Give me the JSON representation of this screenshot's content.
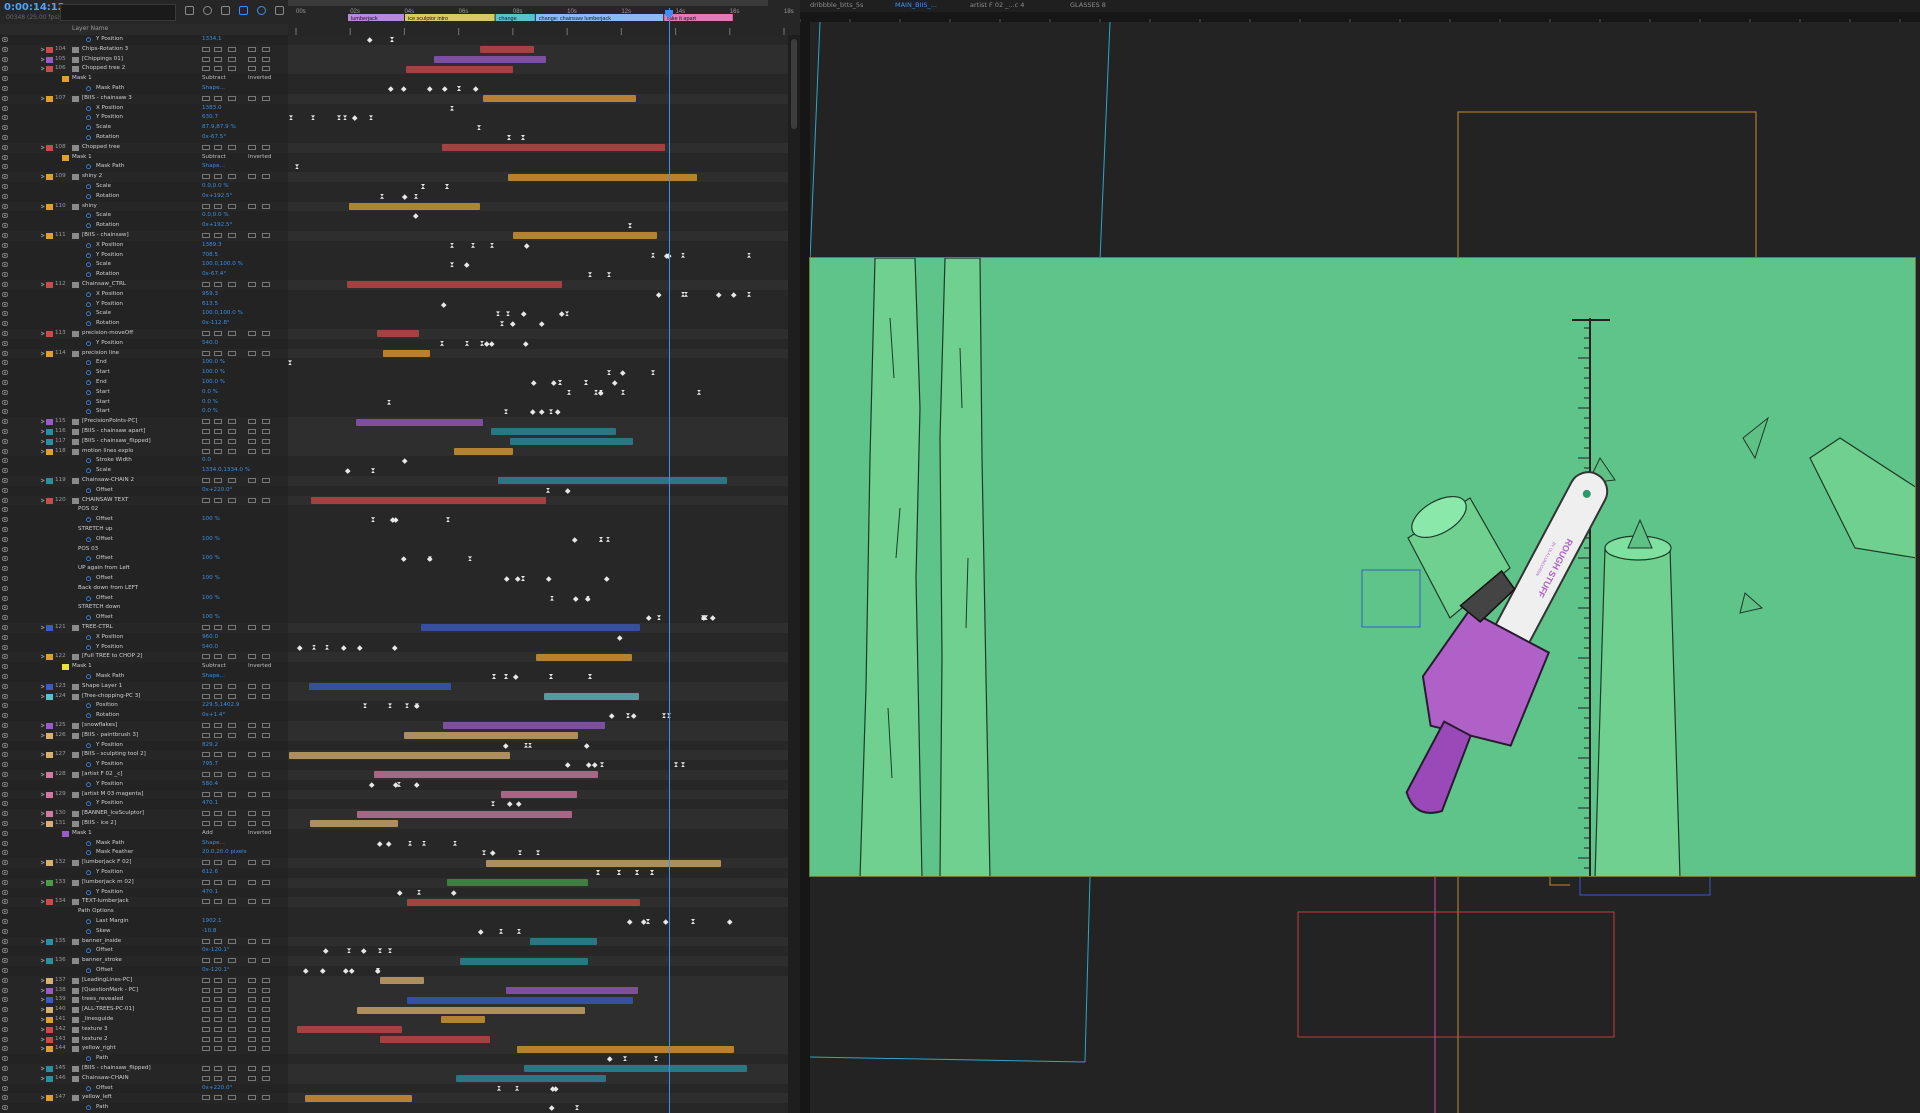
{
  "timeline": {
    "timecode": "0:00:14:12",
    "timecode_sub": "00348 (25.00 fps)",
    "search_placeholder": "",
    "layer_name_header": "Layer Name",
    "ruler_ticks": [
      "00s",
      "02s",
      "04s",
      "06s",
      "08s",
      "10s",
      "12s",
      "14s",
      "16s",
      "18s"
    ],
    "markers": [
      {
        "label": "lumberjack",
        "color": "#b68ad8"
      },
      {
        "label": "ice sculptor intro",
        "color": "#d8c86a"
      },
      {
        "label": "change",
        "color": "#5bc2c8"
      },
      {
        "label": "change: chainsaw lumberjack",
        "color": "#8fb8f0"
      },
      {
        "label": "take it apart",
        "color": "#e07ab8"
      }
    ],
    "rows": [
      {
        "k": "p",
        "name": "Y Position",
        "value": "1334.1",
        "kf": [
          [
            0,
            "x"
          ]
        ]
      },
      {
        "k": "l",
        "n": "104",
        "name": "Chips-Rotation 3",
        "color": "#cc4a4a"
      },
      {
        "k": "l",
        "n": "105",
        "name": "[Chippings 01]",
        "color": "#9a5bc8"
      },
      {
        "k": "l",
        "n": "106",
        "name": "Chopped tree 2",
        "color": "#cc4a4a"
      },
      {
        "k": "m",
        "name": "Mask 1",
        "color": "#e0a030",
        "mode": "Subtract",
        "inv": "Inverted"
      },
      {
        "k": "p",
        "name": "Mask Path",
        "value": "Shape..."
      },
      {
        "k": "l",
        "n": "107",
        "name": "[BIIS - chainsaw 3",
        "color": "#e0a030"
      },
      {
        "k": "p",
        "name": "X Position",
        "value": "1383.0"
      },
      {
        "k": "p",
        "name": "Y Position",
        "value": "630.7"
      },
      {
        "k": "p",
        "name": "Scale",
        "value": "87.9,87.9 %"
      },
      {
        "k": "p",
        "name": "Rotation",
        "value": "0x-67.5°"
      },
      {
        "k": "l",
        "n": "108",
        "name": "Chopped tree",
        "color": "#cc4a4a"
      },
      {
        "k": "m",
        "name": "Mask 1",
        "color": "#e0a030",
        "mode": "Subtract",
        "inv": "Inverted"
      },
      {
        "k": "p",
        "name": "Mask Path",
        "value": "Shape..."
      },
      {
        "k": "l",
        "n": "109",
        "name": "shiny 2",
        "color": "#e0a030"
      },
      {
        "k": "p",
        "name": "Scale",
        "value": "0.0,0.0 %"
      },
      {
        "k": "p",
        "name": "Rotation",
        "value": "0x+192.5°"
      },
      {
        "k": "l",
        "n": "110",
        "name": "shiny",
        "color": "#e0a030"
      },
      {
        "k": "p",
        "name": "Scale",
        "value": "0.0,0.0 %"
      },
      {
        "k": "p",
        "name": "Rotation",
        "value": "0x+192.5°"
      },
      {
        "k": "l",
        "n": "111",
        "name": "[BIIS - chainsaw]",
        "color": "#e0a030"
      },
      {
        "k": "p",
        "name": "X Position",
        "value": "1389.3"
      },
      {
        "k": "p",
        "name": "Y Position",
        "value": "708.5"
      },
      {
        "k": "p",
        "name": "Scale",
        "value": "100.0,100.0 %"
      },
      {
        "k": "p",
        "name": "Rotation",
        "value": "0x-67.4°"
      },
      {
        "k": "l",
        "n": "112",
        "name": "Chainsaw_CTRL",
        "color": "#cc4a4a"
      },
      {
        "k": "p",
        "name": "X Position",
        "value": "959.3"
      },
      {
        "k": "p",
        "name": "Y Position",
        "value": "613.5"
      },
      {
        "k": "p",
        "name": "Scale",
        "value": "100.0,100.0 %"
      },
      {
        "k": "p",
        "name": "Rotation",
        "value": "0x-112.8°"
      },
      {
        "k": "l",
        "n": "113",
        "name": "precision-moveOff",
        "color": "#cc4a4a"
      },
      {
        "k": "p",
        "name": "Y Position",
        "value": "540.0"
      },
      {
        "k": "l",
        "n": "114",
        "name": "precision line",
        "color": "#e0a030"
      },
      {
        "k": "p",
        "name": "End",
        "value": "100.0 %"
      },
      {
        "k": "p",
        "name": "Start",
        "value": "100.0 %"
      },
      {
        "k": "p",
        "name": "End",
        "value": "100.0 %"
      },
      {
        "k": "p",
        "name": "Start",
        "value": "0.0 %"
      },
      {
        "k": "p",
        "name": "Start",
        "value": "0.0 %"
      },
      {
        "k": "p",
        "name": "Start",
        "value": "0.0 %"
      },
      {
        "k": "l",
        "n": "115",
        "name": "[PrecisionPoints-PC]",
        "color": "#9a5bc8"
      },
      {
        "k": "l",
        "n": "116",
        "name": "[BIIS - chainsaw apart]",
        "color": "#2a8fa0"
      },
      {
        "k": "l",
        "n": "117",
        "name": "[BIIS - chainsaw_flipped]",
        "color": "#2a8fa0"
      },
      {
        "k": "l",
        "n": "118",
        "name": "motion lines explo",
        "color": "#e0a030"
      },
      {
        "k": "p",
        "name": "Stroke Width",
        "value": "0.0"
      },
      {
        "k": "p",
        "name": "Scale",
        "value": "1334.0,1334.0 %"
      },
      {
        "k": "l",
        "n": "119",
        "name": "Chainsaw-CHAIN 2",
        "color": "#2a8fa0"
      },
      {
        "k": "p",
        "name": "Offset",
        "value": "0x+220.0°"
      },
      {
        "k": "l",
        "n": "120",
        "name": "CHAINSAW TEXT",
        "color": "#cc4a4a"
      },
      {
        "k": "g",
        "name": "POS 02"
      },
      {
        "k": "p",
        "name": "Offset",
        "value": "100 %"
      },
      {
        "k": "g",
        "name": "STRETCH up"
      },
      {
        "k": "p",
        "name": "Offset",
        "value": "100 %"
      },
      {
        "k": "g",
        "name": "POS 03"
      },
      {
        "k": "p",
        "name": "Offset",
        "value": "100 %"
      },
      {
        "k": "g",
        "name": "UP again from Left"
      },
      {
        "k": "p",
        "name": "Offset",
        "value": "100 %"
      },
      {
        "k": "g",
        "name": "Back down from LEFT"
      },
      {
        "k": "p",
        "name": "Offset",
        "value": "100 %"
      },
      {
        "k": "g",
        "name": "STRETCH down"
      },
      {
        "k": "p",
        "name": "Offset",
        "value": "100 %"
      },
      {
        "k": "l",
        "n": "121",
        "name": "TREE-CTRL",
        "color": "#3a5bc8"
      },
      {
        "k": "p",
        "name": "X Position",
        "value": "960.0"
      },
      {
        "k": "p",
        "name": "Y Position",
        "value": "540.0"
      },
      {
        "k": "l",
        "n": "122",
        "name": "[Full TREE to CHOP 2]",
        "color": "#e0a030"
      },
      {
        "k": "m",
        "name": "Mask 1",
        "color": "#e8e040",
        "mode": "Subtract",
        "inv": "Inverted"
      },
      {
        "k": "p",
        "name": "Mask Path",
        "value": "Shape..."
      },
      {
        "k": "l",
        "n": "123",
        "name": "Shape Layer 1",
        "color": "#3a5bc8"
      },
      {
        "k": "l",
        "n": "124",
        "name": "[Tree-chopping-PC 3]",
        "color": "#5bc2c8"
      },
      {
        "k": "p",
        "name": "Position",
        "value": "229.5,1402.9"
      },
      {
        "k": "p",
        "name": "Rotation",
        "value": "0x+1.4°"
      },
      {
        "k": "l",
        "n": "125",
        "name": "[snowflakes]",
        "color": "#9a5bc8"
      },
      {
        "k": "l",
        "n": "126",
        "name": "[BIIS - paintbrush 3]",
        "color": "#d8b070"
      },
      {
        "k": "p",
        "name": "Y Position",
        "value": "829.2"
      },
      {
        "k": "l",
        "n": "127",
        "name": "[BIIS - sculpting tool 2]",
        "color": "#d8b070"
      },
      {
        "k": "p",
        "name": "Y Position",
        "value": "795.7"
      },
      {
        "k": "l",
        "n": "128",
        "name": "[artist F 02 _c]",
        "color": "#d07aa0"
      },
      {
        "k": "p",
        "name": "Y Position",
        "value": "580.4"
      },
      {
        "k": "l",
        "n": "129",
        "name": "[artist M 03 magenta]",
        "color": "#d07aa0"
      },
      {
        "k": "p",
        "name": "Y Position",
        "value": "470.1"
      },
      {
        "k": "l",
        "n": "130",
        "name": "[BANNER_IceSculptor]",
        "color": "#d07aa0"
      },
      {
        "k": "l",
        "n": "131",
        "name": "[BIIS - ice 2]",
        "color": "#d8b070"
      },
      {
        "k": "m",
        "name": "Mask 1",
        "color": "#9a5bc8",
        "mode": "Add",
        "inv": "Inverted"
      },
      {
        "k": "p",
        "name": "Mask Path",
        "value": "Shape..."
      },
      {
        "k": "p",
        "name": "Mask Feather",
        "value": "20.0,20.0 pixels"
      },
      {
        "k": "l",
        "n": "132",
        "name": "[lumberjack F 02]",
        "color": "#d8b070"
      },
      {
        "k": "p",
        "name": "Y Position",
        "value": "612.6"
      },
      {
        "k": "l",
        "n": "133",
        "name": "[lumberjack m 02]",
        "color": "#4a9a4a"
      },
      {
        "k": "p",
        "name": "Y Position",
        "value": "470.1"
      },
      {
        "k": "l",
        "n": "134",
        "name": "TEXT-lumberjack",
        "color": "#cc4a4a"
      },
      {
        "k": "g",
        "name": "Path Options"
      },
      {
        "k": "p",
        "name": "Last Margin",
        "value": "1902.1"
      },
      {
        "k": "p",
        "name": "Skew",
        "value": "-10.8"
      },
      {
        "k": "l",
        "n": "135",
        "name": "banner_inside",
        "color": "#2a8fa0"
      },
      {
        "k": "p",
        "name": "Offset",
        "value": "0x-120.1°"
      },
      {
        "k": "l",
        "n": "136",
        "name": "banner_stroke",
        "color": "#2a8fa0"
      },
      {
        "k": "p",
        "name": "Offset",
        "value": "0x-120.1°"
      },
      {
        "k": "l",
        "n": "137",
        "name": "[LeadingLines-PC]",
        "color": "#d8b070"
      },
      {
        "k": "l",
        "n": "138",
        "name": "[QuestionMark - PC]",
        "color": "#9a5bc8"
      },
      {
        "k": "l",
        "n": "139",
        "name": "trees_revealed",
        "color": "#3a5bc8"
      },
      {
        "k": "l",
        "n": "140",
        "name": "[ALL-TREES-PC-01]",
        "color": "#d8b070"
      },
      {
        "k": "l",
        "n": "141",
        "name": "_linesguide",
        "color": "#e0a030"
      },
      {
        "k": "l",
        "n": "142",
        "name": "texture 3",
        "color": "#cc4a4a"
      },
      {
        "k": "l",
        "n": "143",
        "name": "texture 2",
        "color": "#cc4a4a"
      },
      {
        "k": "l",
        "n": "144",
        "name": "yellow_right",
        "color": "#e0a030"
      },
      {
        "k": "p",
        "name": "Path",
        "value": ""
      },
      {
        "k": "l",
        "n": "145",
        "name": "[BIIS - chainsaw_flipped]",
        "color": "#2a8fa0"
      },
      {
        "k": "l",
        "n": "146",
        "name": "Chainsaw-CHAIN",
        "color": "#2a8fa0"
      },
      {
        "k": "p",
        "name": "Offset",
        "value": "0x+220.0°"
      },
      {
        "k": "l",
        "n": "147",
        "name": "yellow_left",
        "color": "#e0a030"
      },
      {
        "k": "p",
        "name": "Path",
        "value": ""
      }
    ]
  },
  "viewer": {
    "tabs": [
      "dribbble_btts_5s",
      "MAIN_BIIS_...",
      "artist F 02 _...c 4",
      "GLASSES 8"
    ],
    "active_tab": 1,
    "blade_text": [
      "ROUGH STUFF",
      "BY OLA LUNDGREN"
    ],
    "colors": {
      "green_bg": "#5ec489",
      "trunk": "#6fd08f",
      "saw_purple": "#b061c8",
      "guide_orange": "#c98a2a",
      "guide_cyan": "#2aa7c9",
      "guide_red": "#c83a3a",
      "guide_blue": "#3a5bc8",
      "guide_magenta": "#c84ab0"
    }
  }
}
